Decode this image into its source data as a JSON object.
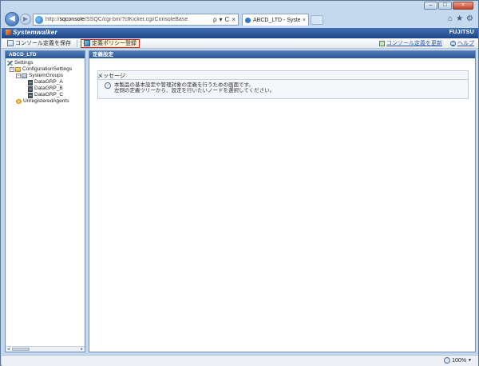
{
  "browser": {
    "address_prefix": "http://",
    "address_host": "sqconsole",
    "address_path": "/SSQC/cgi-bin/?cfKicker.cgi/ConsoleBase",
    "tab_title": "ABCD_LTD - Systemwal...",
    "tab_close": "×",
    "addr_search": "ρ",
    "addr_refresh": "C",
    "addr_stop": "×",
    "addr_dropdown": "▾",
    "home_icon": "⌂",
    "favorites_icon": "★",
    "tools_icon": "⚙",
    "minimize": "–",
    "maximize": "□",
    "close": "×"
  },
  "app": {
    "product_name": "Systemwalker",
    "vendor": "FUJITSU"
  },
  "toolbar": {
    "save_label": "コンソール定義を保存",
    "register_label": "定義ポリシー登録",
    "refresh_label": "コンソール定義を更新",
    "help_label": "ヘルプ"
  },
  "left_panel": {
    "title": "ABCD_LTD",
    "tree": [
      {
        "label": "Settings"
      },
      {
        "label": "ConfigurationSettings"
      },
      {
        "label": "SystemGroups"
      },
      {
        "label": "DataGRP_A"
      },
      {
        "label": "DataGRP_B"
      },
      {
        "label": "DataGRP_C"
      },
      {
        "label": "UnregisteredAgents"
      }
    ]
  },
  "right_panel": {
    "title": "定義設定",
    "message_heading": "メッセージ",
    "message_line1": "本製品の基本設定や管理対象の定義を行うための画面です。",
    "message_line2": "左側の定義ツリーから、設定を行いたいノードを選択してください。"
  },
  "status": {
    "zoom": "100%"
  }
}
